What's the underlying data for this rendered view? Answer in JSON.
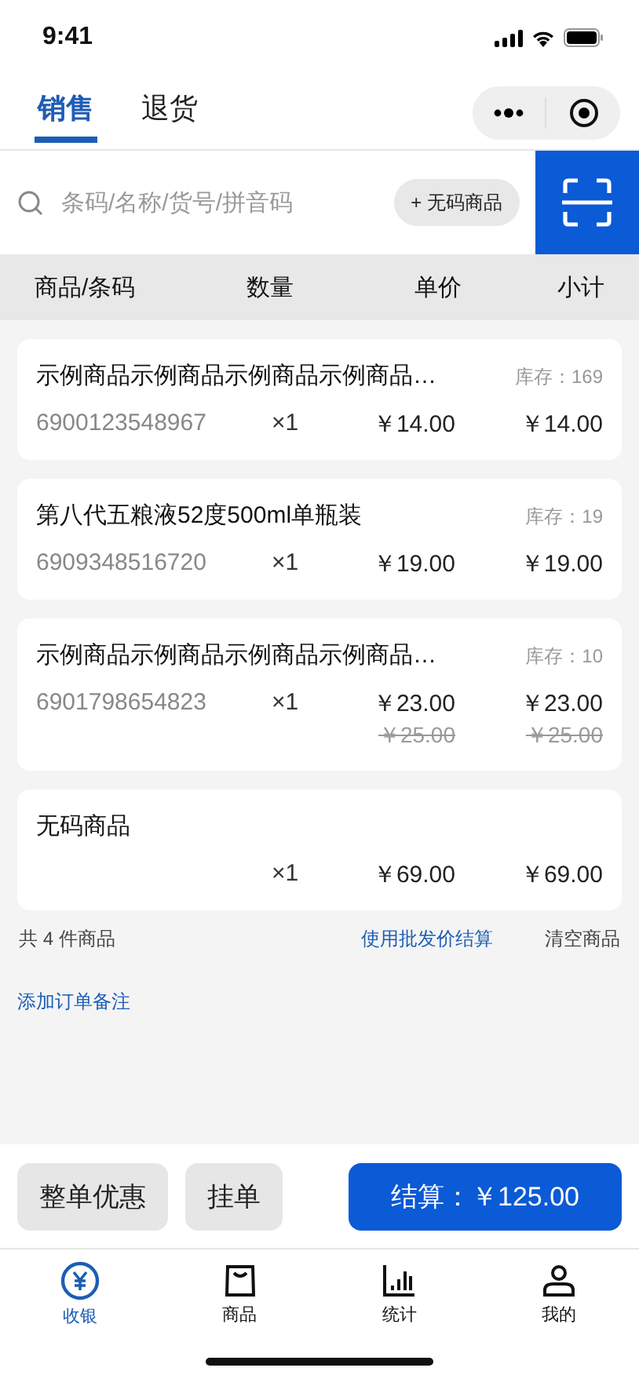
{
  "status_bar": {
    "time": "9:41"
  },
  "tabs": [
    {
      "label": "销售",
      "selected": true
    },
    {
      "label": "退货",
      "selected": false
    }
  ],
  "search": {
    "placeholder": "条码/名称/货号/拼音码",
    "no_code_button": "+ 无码商品"
  },
  "table": {
    "columns": [
      "商品/条码",
      "数量",
      "单价",
      "小计"
    ],
    "rows": [
      {
        "name": "示例商品示例商品示例商品示例商品…",
        "stock": "库存：169",
        "barcode": "6900123548967",
        "qty": "×1",
        "unit_price": "￥14.00",
        "subtotal": "￥14.00"
      },
      {
        "name": "第八代五粮液52度500ml单瓶装",
        "stock": "库存：19",
        "barcode": "6909348516720",
        "qty": "×1",
        "unit_price": "￥19.00",
        "subtotal": "￥19.00"
      },
      {
        "name": "示例商品示例商品示例商品示例商品…",
        "stock": "库存：10",
        "barcode": "6901798654823",
        "qty": "×1",
        "unit_price": "￥23.00",
        "subtotal": "￥23.00",
        "original_unit_price": "￥25.00",
        "original_subtotal": "￥25.00"
      },
      {
        "name": "无码商品",
        "qty": "×1",
        "unit_price": "￥69.00",
        "subtotal": "￥69.00"
      }
    ]
  },
  "summary": {
    "count": "共 4 件商品",
    "wholesale_link": "使用批发价结算",
    "clear": "清空商品",
    "add_note": "添加订单备注"
  },
  "actions": {
    "discount": "整单优惠",
    "hold": "挂单",
    "checkout": "结算：￥125.00"
  },
  "tab_bar": [
    {
      "label": "收银",
      "kind": "yuan",
      "selected": true
    },
    {
      "label": "商品",
      "kind": "bag",
      "selected": false
    },
    {
      "label": "统计",
      "kind": "chart",
      "selected": false
    },
    {
      "label": "我的",
      "kind": "person",
      "selected": false
    }
  ]
}
